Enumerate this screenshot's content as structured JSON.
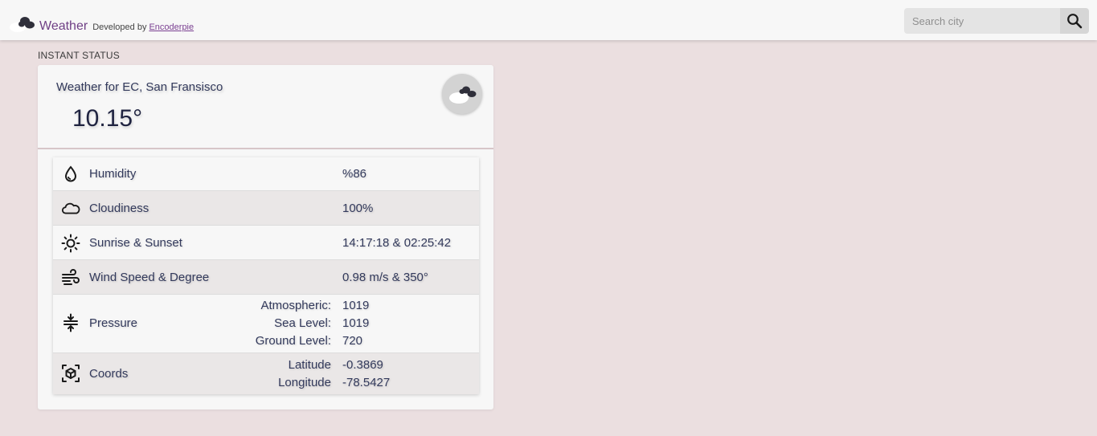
{
  "nav": {
    "logo_icon": "clouds-logo-icon",
    "title": "Weather",
    "developed_by": "Developed by",
    "developer_link": "Encoderpie",
    "search_placeholder": "Search city",
    "search_value": "",
    "search_icon": "search-icon"
  },
  "section_label": "INSTANT STATUS",
  "weather": {
    "title": "Weather for EC, San Fransisco",
    "temperature": "10.15°",
    "condition_icon": "clouds-icon"
  },
  "details": {
    "humidity": {
      "label": "Humidity",
      "value": "%86",
      "icon": "droplet-icon"
    },
    "cloudiness": {
      "label": "Cloudiness",
      "value": "100%",
      "icon": "cloud-icon"
    },
    "sun": {
      "label": "Sunrise & Sunset",
      "value": "14:17:18 & 02:25:42",
      "icon": "sun-icon"
    },
    "wind": {
      "label": "Wind Speed & Degree",
      "value": "0.98 m/s & 350°",
      "icon": "wind-icon"
    },
    "pressure": {
      "label": "Pressure",
      "icon": "pressure-icon",
      "rows": [
        {
          "key": "Atmospheric:",
          "value": "1019"
        },
        {
          "key": "Sea Level:",
          "value": "1019"
        },
        {
          "key": "Ground Level:",
          "value": "720"
        }
      ]
    },
    "coords": {
      "label": "Coords",
      "icon": "coords-icon",
      "rows": [
        {
          "key": "Latitude",
          "value": "-0.3869"
        },
        {
          "key": "Longitude",
          "value": "-78.5427"
        }
      ]
    }
  }
}
